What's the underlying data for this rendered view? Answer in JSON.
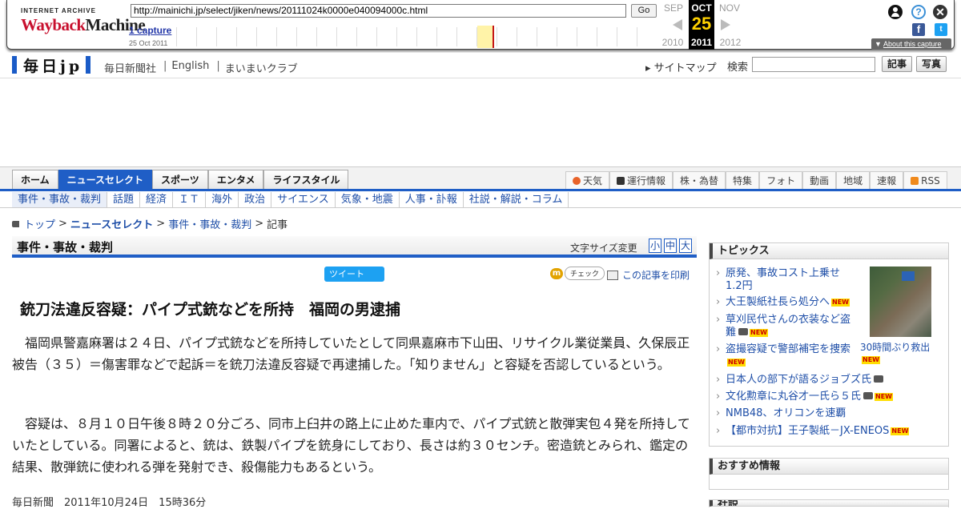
{
  "wayback": {
    "logo_top": "INTERNET ARCHIVE",
    "logo_word1": "Wayback",
    "logo_word2": "Machine",
    "url": "http://mainichi.jp/select/jiken/news/20111024k0000e040094000c.html",
    "go_label": "Go",
    "captures_link": "1 capture",
    "capture_date": "25 Oct 2011",
    "prev_month": "SEP",
    "cur_month": "OCT",
    "next_month": "NOV",
    "cur_day": "25",
    "prev_year": "2010",
    "cur_year": "2011",
    "next_year": "2012",
    "about_label": "About this capture",
    "about_marker": "▼",
    "help_icon": "?",
    "close_icon": "✕",
    "facebook_icon": "f",
    "twitter_icon": "t"
  },
  "header": {
    "logo": "毎日jp",
    "links": [
      "毎日新聞社",
      "English",
      "まいまいクラブ"
    ],
    "link_separator": "|",
    "sitemap": "サイトマップ",
    "sitemap_marker": "▸",
    "search_label": "検索",
    "search_value": "",
    "btn_article": "記事",
    "btn_photo": "写真"
  },
  "nav": {
    "tabs": [
      {
        "label": "ホーム"
      },
      {
        "label": "ニュースセレクト"
      },
      {
        "label": "スポーツ"
      },
      {
        "label": "エンタメ"
      },
      {
        "label": "ライフスタイル"
      }
    ],
    "right": [
      "天気",
      "運行情報",
      "株・為替",
      "特集",
      "フォト",
      "動画",
      "地域",
      "速報",
      "RSS"
    ],
    "sub": [
      "事件・事故・裁判",
      "話題",
      "経済",
      "ＩＴ",
      "海外",
      "政治",
      "サイエンス",
      "気象・地震",
      "人事・訃報",
      "社説・解説・コラム"
    ]
  },
  "breadcrumb": {
    "items": [
      "トップ",
      "ニュースセレクト",
      "事件・事故・裁判",
      "記事"
    ],
    "separator": ">"
  },
  "section": {
    "title": "事件・事故・裁判",
    "font_size_label": "文字サイズ変更",
    "sizes": [
      "小",
      "中",
      "大"
    ]
  },
  "share": {
    "tweet": "ツイート",
    "check_icon": "m",
    "check": "チェック",
    "print": "この記事を印刷"
  },
  "article": {
    "headline": "銃刀法違反容疑：パイプ式銃などを所持　福岡の男逮捕",
    "paragraphs": [
      "福岡県警嘉麻署は２４日、パイプ式銃などを所持していたとして同県嘉麻市下山田、リサイクル業従業員、久保辰正被告（３５）＝傷害罪などで起訴＝を銃刀法違反容疑で再逮捕した。「知りません」と容疑を否認しているという。",
      "容疑は、８月１０日午後８時２０分ごろ、同市上臼井の路上に止めた車内で、パイプ式銃と散弾実包４発を所持していたとしている。同署によると、銃は、鉄製パイプを銃身にしており、長さは約３０センチ。密造銃とみられ、鑑定の結果、散弾銃に使われる弾を発射でき、殺傷能力もあるという。"
    ],
    "byline": "毎日新聞　2011年10月24日　15時36分"
  },
  "sidebar": {
    "topics_title": "トピックス",
    "new_badge": "NEW",
    "topics": [
      {
        "label": "原発、事故コスト上乗せ　1.2円",
        "new": false,
        "cam": false
      },
      {
        "label": "大王製紙社長ら処分へ",
        "new": true,
        "cam": false
      },
      {
        "label": "草刈民代さんの衣装など盗難",
        "new": true,
        "cam": true
      },
      {
        "label": "盗撮容疑で警部補宅を捜索",
        "new": true,
        "cam": false
      },
      {
        "label": "日本人の部下が語るジョブズ氏",
        "new": false,
        "cam": true
      },
      {
        "label": "文化勲章に丸谷才一氏ら５氏",
        "new": true,
        "cam": true
      },
      {
        "label": "NMB48、オリコンを速覇",
        "new": false,
        "cam": false
      },
      {
        "label": "【都市対抗】王子製紙－JX-ENEOS",
        "new": true,
        "cam": false
      }
    ],
    "photo_caption": "30時間ぶり救出",
    "photo_new": true,
    "recommend_title": "おすすめ情報",
    "next_title": "社説"
  }
}
